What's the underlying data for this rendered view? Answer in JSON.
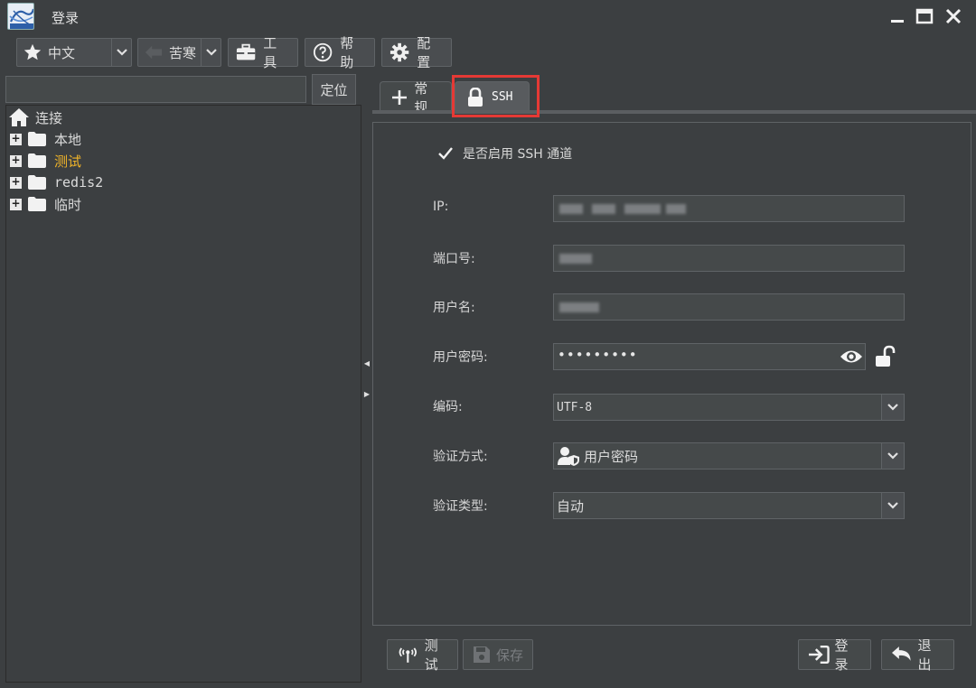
{
  "window": {
    "title": "登录"
  },
  "toolbar": {
    "language": "中文",
    "theme": "苦寒",
    "tools_label": "工具",
    "help_label": "帮助",
    "config_label": "配置"
  },
  "sidebar": {
    "search_value": "",
    "locate_label": "定位",
    "root_label": "连接",
    "items": [
      {
        "label": "本地",
        "color": "#dcdcdc"
      },
      {
        "label": "测试",
        "color": "#f0b429"
      },
      {
        "label": "redis2",
        "color": "#dcdcdc"
      },
      {
        "label": "临时",
        "color": "#dcdcdc"
      }
    ]
  },
  "tabs": [
    {
      "label": "常规",
      "icon": "plus-icon"
    },
    {
      "label": "SSH",
      "icon": "lock-icon"
    }
  ],
  "ssh_form": {
    "enable_label": "是否启用 SSH 通道",
    "enable_checked": true,
    "ip_label": "IP:",
    "port_label": "端口号:",
    "username_label": "用户名:",
    "password_label": "用户密码:",
    "password_value": "•••••••••",
    "encoding_label": "编码:",
    "encoding_value": "UTF-8",
    "auth_method_label": "验证方式:",
    "auth_method_value": "用户密码",
    "auth_type_label": "验证类型:",
    "auth_type_value": "自动"
  },
  "footer": {
    "test_label": "测试",
    "save_label": "保存",
    "login_label": "登录",
    "exit_label": "退出"
  }
}
